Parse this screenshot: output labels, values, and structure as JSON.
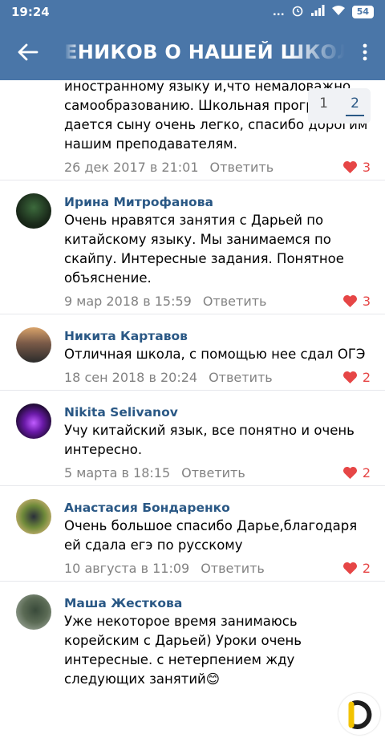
{
  "status": {
    "time": "19:24",
    "dots": "...",
    "battery": "54"
  },
  "header": {
    "title": "ЕНИКОВ О НАШЕЙ ШКОЛ"
  },
  "pager": {
    "pages": [
      "1",
      "2"
    ],
    "active": "2"
  },
  "comments": [
    {
      "author": "",
      "text": "иностранному языку и,что немаловажно, самообразованию. Школьная программа дается сыну очень легко, спасибо дорогим нашим преподавателям.",
      "date": "26 дек 2017 в 21:01",
      "reply": "Ответить",
      "likes": "3"
    },
    {
      "author": "Ирина Митрофанова",
      "text": "Очень нравятся занятия с Дарьей по китайскому языку. Мы занимаемся по скайпу. Интересные задания. Понятное объяснение.",
      "date": "9 мар 2018 в 15:59",
      "reply": "Ответить",
      "likes": "3"
    },
    {
      "author": "Никита Картавов",
      "text": "Отличная школа, с помощью нее сдал ОГЭ",
      "date": "18 сен 2018 в 20:24",
      "reply": "Ответить",
      "likes": "2"
    },
    {
      "author": "Nikita Selivanov",
      "text": "Учу китайский язык, все понятно и очень интересно.",
      "date": "5 марта в 18:15",
      "reply": "Ответить",
      "likes": "2"
    },
    {
      "author": "Анастасия Бондаренко",
      "text": "Очень большое спасибо Дарье,благодаря ей сдала егэ по русскому",
      "date": "10 августа в 11:09",
      "reply": "Ответить",
      "likes": "2"
    },
    {
      "author": "Маша Жесткова",
      "text": "Уже некоторое время занимаюсь корейским с Дарьей) Уроки очень интересные. с нетерпением жду следующих занятий😊",
      "date": "",
      "reply": "",
      "likes": ""
    }
  ],
  "colors": {
    "accent": "#4a76a8",
    "author": "#2a5885",
    "like": "#e64646",
    "meta": "#828282"
  }
}
